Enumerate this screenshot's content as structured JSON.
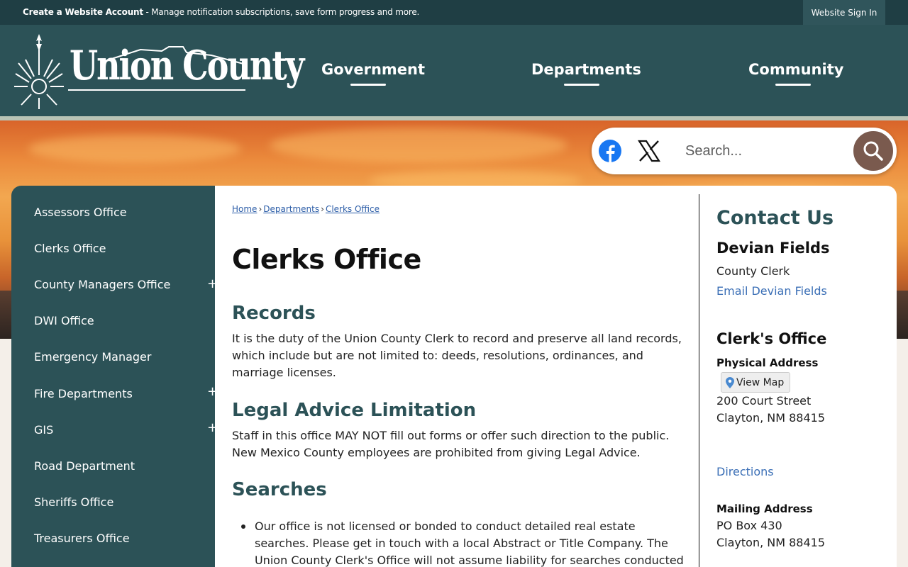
{
  "topbar": {
    "account_link": "Create a Website Account",
    "account_desc": " - Manage notification subscriptions, save form progress and more.",
    "signin": "Website Sign In"
  },
  "logo": {
    "text": "Union County"
  },
  "nav": [
    {
      "label": "Government"
    },
    {
      "label": "Departments"
    },
    {
      "label": "Community"
    }
  ],
  "search": {
    "placeholder": "Search..."
  },
  "sidebar": {
    "items": [
      {
        "label": "Assessors Office",
        "expandable": false
      },
      {
        "label": "Clerks Office",
        "expandable": false
      },
      {
        "label": "County Managers Office",
        "expandable": true
      },
      {
        "label": "DWI Office",
        "expandable": false
      },
      {
        "label": "Emergency Manager",
        "expandable": false
      },
      {
        "label": "Fire Departments",
        "expandable": true
      },
      {
        "label": "GIS",
        "expandable": true
      },
      {
        "label": "Road Department",
        "expandable": false
      },
      {
        "label": "Sheriffs Office",
        "expandable": false
      },
      {
        "label": "Treasurers Office",
        "expandable": false
      }
    ],
    "expand_symbol": "+"
  },
  "breadcrumb": {
    "home": "Home",
    "departments": "Departments",
    "current": "Clerks Office",
    "separator": "›"
  },
  "main": {
    "title": "Clerks Office",
    "records_heading": "Records",
    "records_text": "It is the duty of the Union County Clerk to record and preserve all land records, which include but are not limited to: deeds, resolutions, ordinances, and marriage licenses.",
    "legal_heading": "Legal Advice Limitation",
    "legal_text": "Staff in this office MAY NOT fill out forms or offer such direction to the public. New Mexico County employees are prohibited from giving Legal Advice.",
    "searches_heading": "Searches",
    "searches_bullet": "Our office is not licensed or bonded to conduct detailed real estate searches. Please get in touch with a local Abstract or Title Company. The Union County Clerk's Office will not assume liability for searches conducted"
  },
  "contact": {
    "heading": "Contact Us",
    "person_name": "Devian Fields",
    "person_title": "County Clerk",
    "email_link": "Email Devian Fields",
    "office_name": "Clerk's Office",
    "physical_label": "Physical Address",
    "view_map": "View Map",
    "street": "200 Court Street",
    "city": "Clayton, NM 88415",
    "directions": "Directions",
    "mailing_label": "Mailing Address",
    "po_box": "PO Box 430",
    "mail_city": "Clayton, NM 88415"
  },
  "colors": {
    "teal": "#2c5257",
    "topbar": "#1f3e44",
    "link": "#3b6fb6",
    "search_btn": "#7a5a4e"
  },
  "icons": [
    "facebook-icon",
    "x-icon",
    "search-icon",
    "map-pin-icon",
    "sun-symbol-icon"
  ]
}
